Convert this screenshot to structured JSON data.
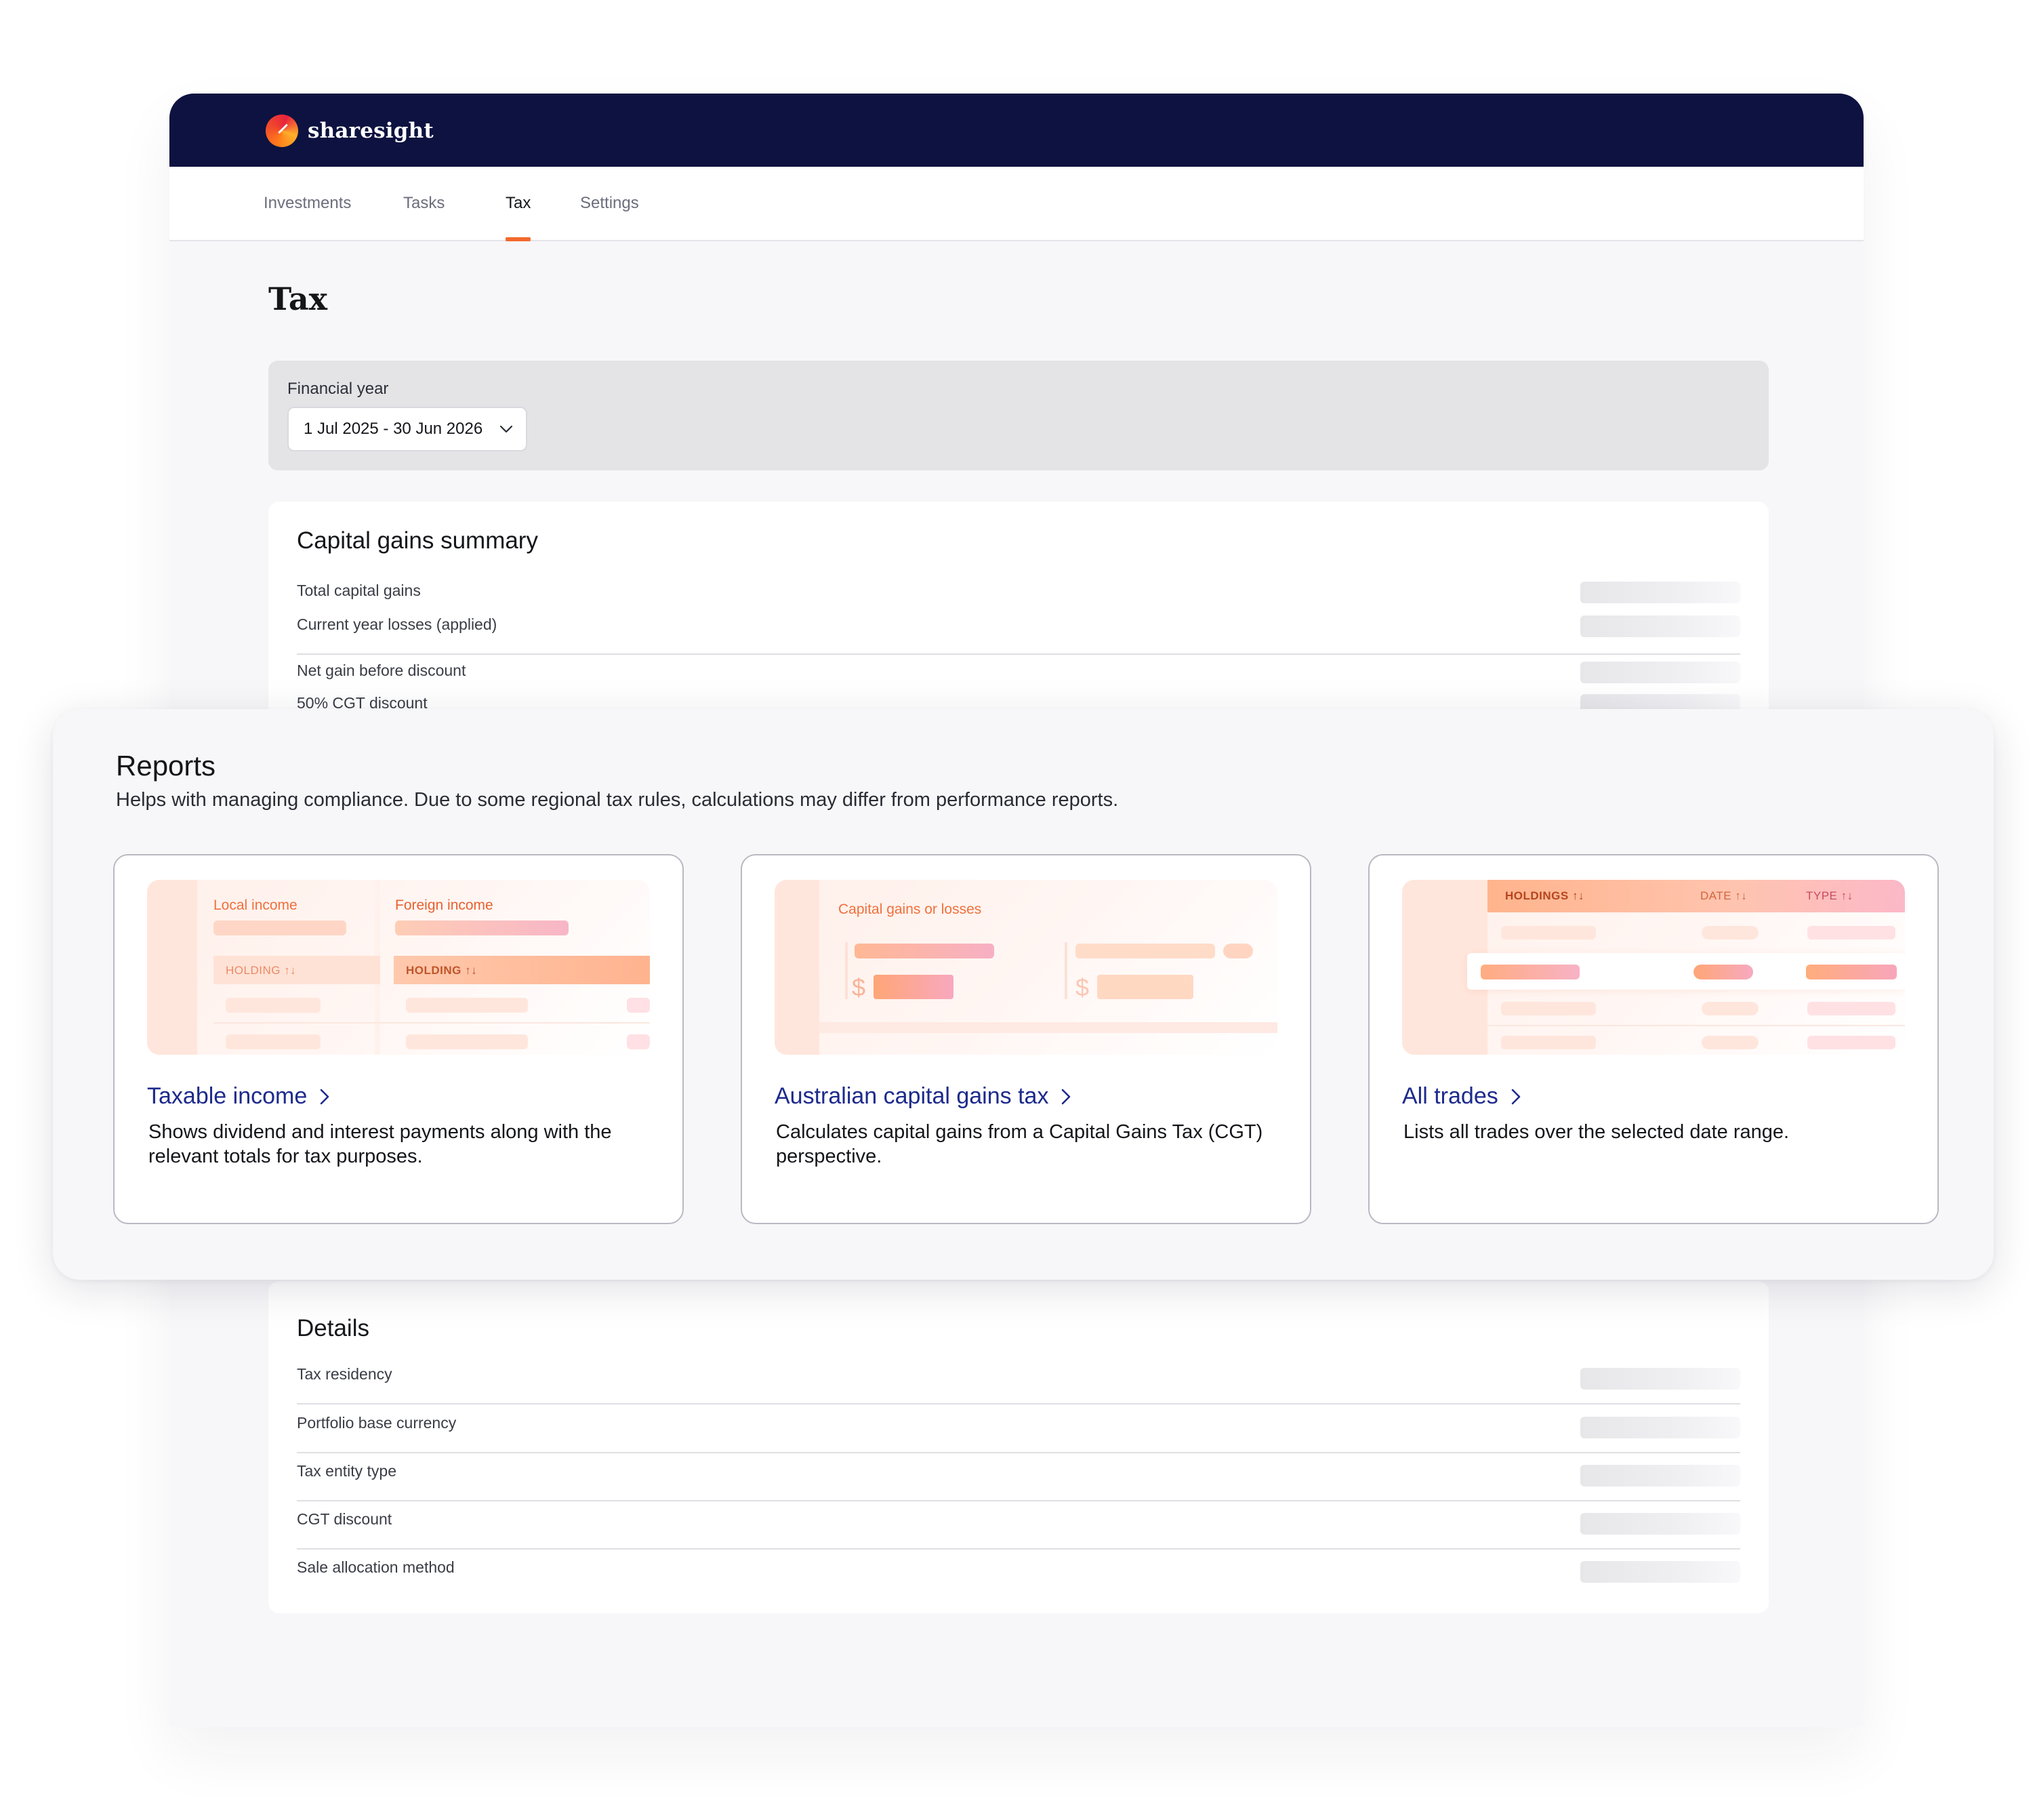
{
  "brand": {
    "name": "sharesight",
    "header_color": "#0e1240",
    "accent_color": "#f26a2e",
    "link_color": "#1d2a8c"
  },
  "nav": {
    "tabs": [
      {
        "label": "Investments",
        "active": false
      },
      {
        "label": "Tasks",
        "active": false
      },
      {
        "label": "Tax",
        "active": true
      },
      {
        "label": "Settings",
        "active": false
      }
    ]
  },
  "page": {
    "title": "Tax"
  },
  "financial_year": {
    "label": "Financial year",
    "selected": "1 Jul 2025 - 30 Jun 2026",
    "icon": "chevron-down-icon"
  },
  "capital_gains_summary": {
    "title": "Capital gains summary",
    "rows": [
      {
        "label": "Total capital gains"
      },
      {
        "label": "Current year losses (applied)"
      },
      {
        "label": "Net gain before discount"
      },
      {
        "label": "50% CGT discount"
      }
    ]
  },
  "reports": {
    "title": "Reports",
    "subtitle": "Helps with managing compliance. Due to some regional tax rules, calculations may differ from performance reports.",
    "cards": [
      {
        "link": "Taxable income",
        "description": "Shows dividend and interest payments along with the relevant totals for tax purposes.",
        "preview": {
          "left_label": "Local income",
          "right_label": "Foreign income",
          "column_header": "HOLDING ↑↓"
        }
      },
      {
        "link": "Australian capital gains tax",
        "description": "Calculates capital gains from a Capital Gains Tax (CGT) perspective.",
        "preview": {
          "label": "Capital gains or losses",
          "currency_symbol": "$"
        }
      },
      {
        "link": "All trades",
        "description": "Lists all trades over the selected date range.",
        "preview": {
          "columns": [
            "HOLDINGS ↑↓",
            "DATE ↑↓",
            "TYPE ↑↓"
          ]
        }
      }
    ]
  },
  "details": {
    "title": "Details",
    "rows": [
      {
        "label": "Tax residency"
      },
      {
        "label": "Portfolio base currency"
      },
      {
        "label": "Tax entity type"
      },
      {
        "label": "CGT discount"
      },
      {
        "label": "Sale allocation method"
      }
    ]
  }
}
